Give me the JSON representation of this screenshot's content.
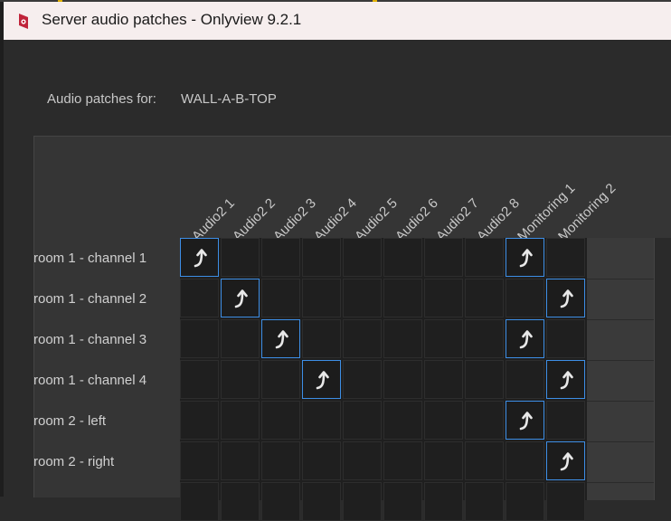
{
  "window": {
    "title": "Server audio patches - Onlyview  9.2.1",
    "icon": "app-logo-icon"
  },
  "patch_for": {
    "label": "Audio patches for:",
    "value": "WALL-A-B-TOP"
  },
  "columns": [
    "Audio2 1",
    "Audio2 2",
    "Audio2 3",
    "Audio2 4",
    "Audio2 5",
    "Audio2 6",
    "Audio2 7",
    "Audio2 8",
    "Monitoring 1",
    "Monitoring 2"
  ],
  "rows": [
    {
      "label": "room 1 - channel 1",
      "patched": [
        0,
        8
      ]
    },
    {
      "label": "room 1 - channel 2",
      "patched": [
        1,
        9
      ]
    },
    {
      "label": "room 1 - channel 3",
      "patched": [
        2,
        8
      ]
    },
    {
      "label": "room 1 - channel 4",
      "patched": [
        3,
        9
      ]
    },
    {
      "label": "room 2 - left",
      "patched": [
        8
      ]
    },
    {
      "label": "room 2 - right",
      "patched": [
        9
      ]
    }
  ],
  "patch_icon": "patch-arrow-icon",
  "colors": {
    "accent": "#3d8ee6",
    "background": "#2b2b2b",
    "titlebar": "#f6eeee"
  }
}
